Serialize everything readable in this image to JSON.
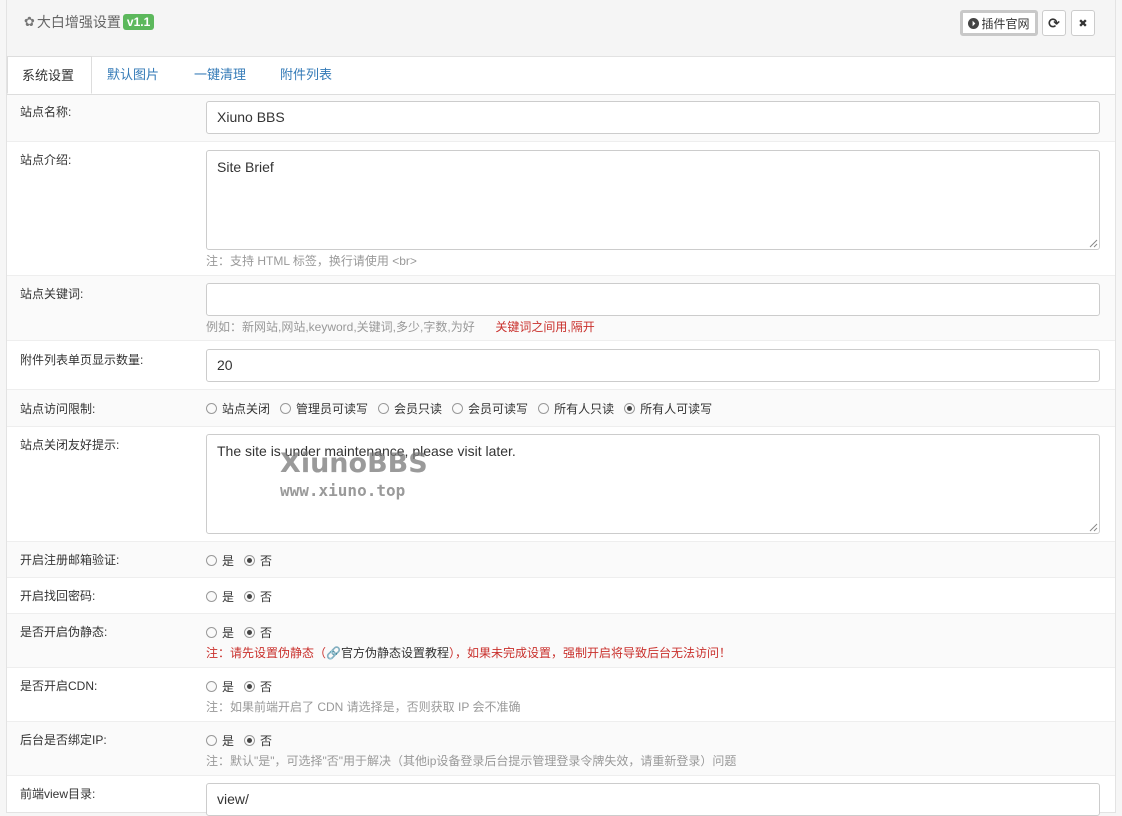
{
  "header": {
    "title": "大白增强设置",
    "version": "v1.1",
    "site_button": "插件官网",
    "refresh_glyph": "⟳",
    "close_glyph": "✖"
  },
  "tabs": [
    "系统设置",
    "默认图片",
    "一键清理",
    "附件列表"
  ],
  "form": {
    "site_name": {
      "label": "站点名称:",
      "value": "Xiuno BBS"
    },
    "site_brief": {
      "label": "站点介绍:",
      "value": "Site Brief",
      "help": "注：支持 HTML 标签，换行请使用 <br>"
    },
    "keywords": {
      "label": "站点关键词:",
      "value": "",
      "help": "例如：新网站,网站,keyword,关键词,多少,字数,为好",
      "help_red": "关键词之间用,隔开"
    },
    "attach_per_page": {
      "label": "附件列表单页显示数量:",
      "value": "20"
    },
    "access": {
      "label": "站点访问限制:",
      "options": [
        "站点关闭",
        "管理员可读写",
        "会员只读",
        "会员可读写",
        "所有人只读",
        "所有人可读写"
      ],
      "selected": "所有人可读写"
    },
    "close_tip": {
      "label": "站点关闭友好提示:",
      "value": "The site is under maintenance, please visit later."
    },
    "email_verify": {
      "label": "开启注册邮箱验证:",
      "yes": "是",
      "no": "否",
      "selected": "否"
    },
    "find_password": {
      "label": "开启找回密码:",
      "yes": "是",
      "no": "否",
      "selected": "否"
    },
    "rewrite": {
      "label": "是否开启伪静态:",
      "yes": "是",
      "no": "否",
      "selected": "否",
      "help_prefix": "注：请先设置伪静态（",
      "help_link": "官方伪静态设置教程",
      "help_suffix": "），如果未完成设置，强制开启将导致后台无法访问！"
    },
    "cdn": {
      "label": "是否开启CDN:",
      "yes": "是",
      "no": "否",
      "selected": "否",
      "help": "注：如果前端开启了 CDN 请选择是，否则获取 IP 会不准确"
    },
    "bind_ip": {
      "label": "后台是否绑定IP:",
      "yes": "是",
      "no": "否",
      "selected": "否",
      "help": "注：默认\"是\"，可选择\"否\"用于解决（其他ip设备登录后台提示管理登录令牌失效，请重新登录）问题"
    },
    "view_dir": {
      "label": "前端view目录:",
      "value": "view/"
    }
  },
  "watermark": {
    "line1": "XiunoBBS",
    "line2": "www.xiuno.top"
  }
}
